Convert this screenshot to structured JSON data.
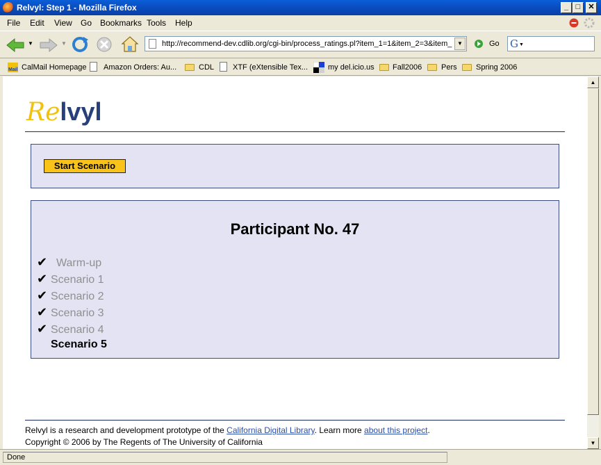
{
  "window": {
    "title": "Relvyl: Step 1 - Mozilla Firefox"
  },
  "menu": [
    "File",
    "Edit",
    "View",
    "Go",
    "Bookmarks",
    "Tools",
    "Help"
  ],
  "toolbar": {
    "url": "http://recommend-dev.cdlib.org/cgi-bin/process_ratings.pl?item_1=1&item_2=3&item_",
    "go_label": "Go",
    "search_value": ""
  },
  "bookmarks": [
    {
      "label": "CalMail Homepage",
      "icon": "mail-icon"
    },
    {
      "label": "Amazon Orders: Au...",
      "icon": "page-icon"
    },
    {
      "label": "CDL",
      "icon": "folder-icon"
    },
    {
      "label": "XTF (eXtensible Tex...",
      "icon": "page-icon"
    },
    {
      "label": "my del.icio.us",
      "icon": "delicious-icon"
    },
    {
      "label": "Fall2006",
      "icon": "folder-icon"
    },
    {
      "label": "Pers",
      "icon": "folder-icon"
    },
    {
      "label": "Spring 2006",
      "icon": "folder-icon"
    }
  ],
  "page": {
    "logo": {
      "part1": "Re",
      "part2": "lvyl"
    },
    "start_button": "Start Scenario",
    "participant": "Participant No. 47",
    "steps": [
      {
        "label": "Warm-up",
        "done": true
      },
      {
        "label": "Scenario 1",
        "done": true
      },
      {
        "label": "Scenario 2",
        "done": true
      },
      {
        "label": "Scenario 3",
        "done": true
      },
      {
        "label": "Scenario 4",
        "done": true
      },
      {
        "label": "Scenario 5",
        "done": false
      }
    ],
    "checkmark": "✔",
    "footer": {
      "text1": "Relvyl is a research and development prototype of the ",
      "link1": "California Digital Library",
      "text2": ". Learn more ",
      "link2": "about this project",
      "text3": ".",
      "copyright": "Copyright © 2006 by The Regents of The University of California"
    }
  },
  "status": "Done",
  "colors": {
    "accent_yellow": "#f9c319",
    "panel_bg": "#e3e3f4",
    "logo_navy": "#28407a"
  }
}
